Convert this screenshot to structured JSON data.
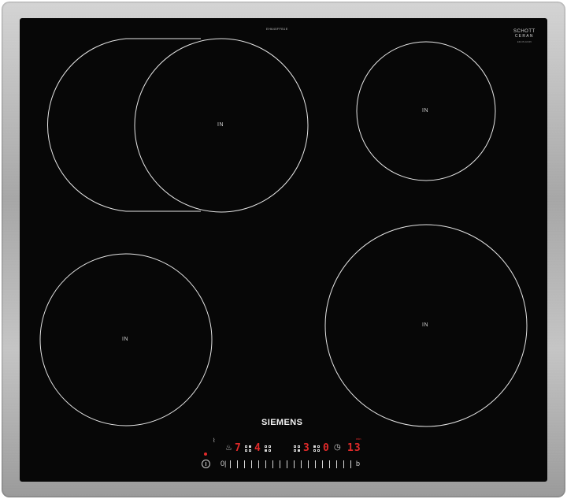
{
  "appliance": {
    "brand": "SIEMENS",
    "model_number": "EH645FFB1E",
    "glass_maker_line1": "SCHOTT",
    "glass_maker_line2": "CERAN",
    "glass_code": "EM-05-02345"
  },
  "zones": [
    {
      "id": "front-left",
      "label": "IN"
    },
    {
      "id": "rear-left-flex",
      "label": "IN"
    },
    {
      "id": "rear-right",
      "label": "IN"
    },
    {
      "id": "front-right",
      "label": "IN"
    }
  ],
  "controls": {
    "display_zone_1": "7",
    "display_zone_2": "4",
    "display_zone_3": "3",
    "display_zone_4": "0",
    "timer_display": "13",
    "timer_label": "min",
    "slider_min_label": "0|",
    "slider_boost_label": "b",
    "zone_icon_1": "zone-select-icon",
    "zone_icon_2": "zone-select-icon",
    "zone_icon_3": "zone-select-icon",
    "zone_icon_4": "zone-select-icon"
  },
  "colors": {
    "glass": "#070707",
    "display": "#e12a2a",
    "frame": "#b5b5b5"
  }
}
